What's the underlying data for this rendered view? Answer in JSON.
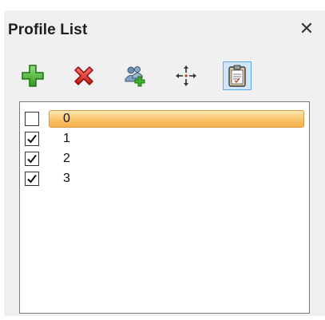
{
  "panel": {
    "title": "Profile List",
    "close_glyph": "✕"
  },
  "toolbar": {
    "buttons": [
      {
        "name": "add-profile-button",
        "icon": "green-plus-icon"
      },
      {
        "name": "delete-profile-button",
        "icon": "red-x-icon"
      },
      {
        "name": "add-group-button",
        "icon": "people-plus-icon"
      },
      {
        "name": "move-button",
        "icon": "move-arrows-icon"
      },
      {
        "name": "clipboard-button",
        "icon": "clipboard-icon",
        "active": true
      }
    ]
  },
  "profiles": [
    {
      "label": "0",
      "checked": false,
      "selected": true
    },
    {
      "label": "1",
      "checked": true,
      "selected": false
    },
    {
      "label": "2",
      "checked": true,
      "selected": false
    },
    {
      "label": "3",
      "checked": true,
      "selected": false
    }
  ],
  "colors": {
    "panel_bg": "#f0f0f0",
    "selection": "#f9c36a",
    "active_button": "#cfe6fb"
  }
}
